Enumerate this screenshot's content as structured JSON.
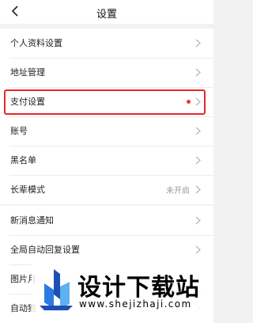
{
  "header": {
    "title": "设置",
    "back_icon": "chevron-left-icon"
  },
  "group1": {
    "items": [
      {
        "label": "个人资料设置"
      },
      {
        "label": "地址管理"
      },
      {
        "label": "支付设置",
        "dot_color": "#e53935"
      },
      {
        "label": "账号"
      },
      {
        "label": "黑名单"
      },
      {
        "label": "长辈模式",
        "value": "未开启"
      }
    ]
  },
  "group2": {
    "items": [
      {
        "label": "新消息通知"
      },
      {
        "label": "全局自动回复设置"
      },
      {
        "label": "图片月"
      },
      {
        "label": "自动猎"
      }
    ]
  },
  "highlight_color": "#e8262b",
  "watermark": {
    "text": "设计下载站",
    "url": "www.shejizhaji.com"
  }
}
